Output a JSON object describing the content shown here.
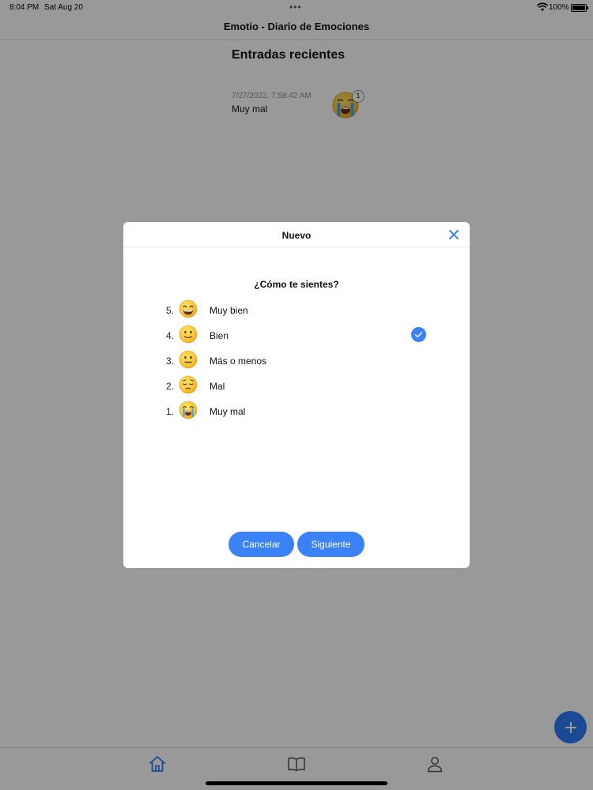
{
  "status_bar": {
    "time": "8:04 PM",
    "date": "Sat Aug 20",
    "battery": "100%"
  },
  "nav": {
    "title": "Emotio - Diario de Emociones"
  },
  "recent": {
    "title": "Entradas recientes",
    "entries": [
      {
        "date": "7/27/2022, 7:58:42 AM",
        "mood": "Muy mal",
        "emoji": "crying-face",
        "count": "1"
      }
    ]
  },
  "modal": {
    "title": "Nuevo",
    "question": "¿Cómo te sientes?",
    "options": [
      {
        "number": "5.",
        "label": "Muy bien",
        "emoji": "grinning-face",
        "selected": false
      },
      {
        "number": "4.",
        "label": "Bien",
        "emoji": "slightly-smiling-face",
        "selected": true
      },
      {
        "number": "3.",
        "label": "Más o menos",
        "emoji": "neutral-face",
        "selected": false
      },
      {
        "number": "2.",
        "label": "Mal",
        "emoji": "pensive-face",
        "selected": false
      },
      {
        "number": "1.",
        "label": "Muy mal",
        "emoji": "crying-face",
        "selected": false
      }
    ],
    "cancel_label": "Cancelar",
    "next_label": "Siguiente"
  },
  "tabs": [
    {
      "icon": "home-icon",
      "active": true
    },
    {
      "icon": "book-icon",
      "active": false
    },
    {
      "icon": "person-icon",
      "active": false
    }
  ],
  "colors": {
    "accent": "#3b82f6",
    "emoji_yellow": "#f7c23a",
    "emoji_outline": "#d99a17",
    "tear_blue": "#4aa3e8"
  }
}
